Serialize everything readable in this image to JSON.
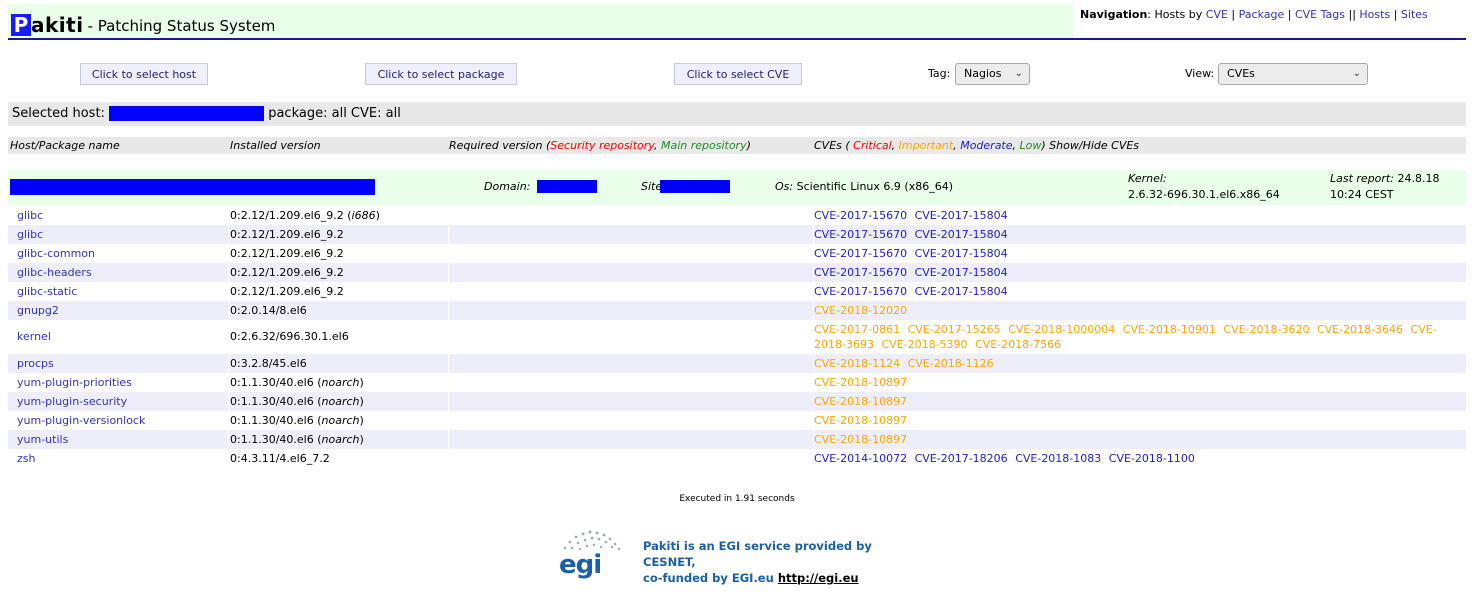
{
  "header": {
    "logo_first": "P",
    "logo_rest": "akiti",
    "subtitle": "- Patching Status System",
    "nav": {
      "label": "Navigation",
      "prefix": ": Hosts by ",
      "items": [
        "CVE",
        "Package",
        "CVE Tags",
        "Hosts",
        "Sites"
      ]
    }
  },
  "selectors": {
    "host_button": "Click to select host",
    "package_button": "Click to select package",
    "cve_button": "Click to select CVE",
    "tag_label": "Tag:",
    "tag_value": "Nagios",
    "view_label": "View:",
    "view_value": "CVEs"
  },
  "selected": {
    "host_label": "Selected host:",
    "package_text": "package: all CVE: all"
  },
  "columns": {
    "name": "Host/Package name",
    "installed": "Installed version",
    "required_prefix": "Required version (",
    "security_repo": "Security repository",
    "main_repo": "Main repository",
    "required_suffix": ")",
    "cves_prefix": "CVEs ( ",
    "critical": "Critical",
    "important": "Important",
    "moderate": "Moderate",
    "low": "Low",
    "cves_suffix": ") Show/Hide CVEs"
  },
  "host": {
    "domain_label": "Domain:",
    "site_label": "Site:",
    "os_label": "Os:",
    "os_value": "Scientific Linux 6.9 (x86_64)",
    "kernel_label": "Kernel:",
    "kernel_value": "2.6.32-696.30.1.el6.x86_64",
    "report_label": "Last report:",
    "report_date": "24.8.18",
    "report_time": "10:24 CEST"
  },
  "packages": [
    {
      "name": "glibc",
      "version": "0:2.12/1.209.el6_9.2",
      "arch": "i686",
      "severity": "moderate",
      "cves": [
        "CVE-2017-15670",
        "CVE-2017-15804"
      ]
    },
    {
      "name": "glibc",
      "version": "0:2.12/1.209.el6_9.2",
      "arch": "",
      "severity": "moderate",
      "cves": [
        "CVE-2017-15670",
        "CVE-2017-15804"
      ]
    },
    {
      "name": "glibc-common",
      "version": "0:2.12/1.209.el6_9.2",
      "arch": "",
      "severity": "moderate",
      "cves": [
        "CVE-2017-15670",
        "CVE-2017-15804"
      ]
    },
    {
      "name": "glibc-headers",
      "version": "0:2.12/1.209.el6_9.2",
      "arch": "",
      "severity": "moderate",
      "cves": [
        "CVE-2017-15670",
        "CVE-2017-15804"
      ]
    },
    {
      "name": "glibc-static",
      "version": "0:2.12/1.209.el6_9.2",
      "arch": "",
      "severity": "moderate",
      "cves": [
        "CVE-2017-15670",
        "CVE-2017-15804"
      ]
    },
    {
      "name": "gnupg2",
      "version": "0:2.0.14/8.el6",
      "arch": "",
      "severity": "important",
      "cves": [
        "CVE-2018-12020"
      ]
    },
    {
      "name": "kernel",
      "version": "0:2.6.32/696.30.1.el6",
      "arch": "",
      "severity": "important",
      "cves": [
        "CVE-2017-0861",
        "CVE-2017-15265",
        "CVE-2018-1000004",
        "CVE-2018-10901",
        "CVE-2018-3620",
        "CVE-2018-3646",
        "CVE-2018-3693",
        "CVE-2018-5390",
        "CVE-2018-7566"
      ]
    },
    {
      "name": "procps",
      "version": "0:3.2.8/45.el6",
      "arch": "",
      "severity": "important",
      "cves": [
        "CVE-2018-1124",
        "CVE-2018-1126"
      ]
    },
    {
      "name": "yum-plugin-priorities",
      "version": "0:1.1.30/40.el6",
      "arch": "noarch",
      "severity": "important",
      "cves": [
        "CVE-2018-10897"
      ]
    },
    {
      "name": "yum-plugin-security",
      "version": "0:1.1.30/40.el6",
      "arch": "noarch",
      "severity": "important",
      "cves": [
        "CVE-2018-10897"
      ]
    },
    {
      "name": "yum-plugin-versionlock",
      "version": "0:1.1.30/40.el6",
      "arch": "noarch",
      "severity": "important",
      "cves": [
        "CVE-2018-10897"
      ]
    },
    {
      "name": "yum-utils",
      "version": "0:1.1.30/40.el6",
      "arch": "noarch",
      "severity": "important",
      "cves": [
        "CVE-2018-10897"
      ]
    },
    {
      "name": "zsh",
      "version": "0:4.3.11/4.el6_7.2",
      "arch": "",
      "severity": "moderate",
      "cves": [
        "CVE-2014-10072",
        "CVE-2017-18206",
        "CVE-2018-1083",
        "CVE-2018-1100"
      ]
    }
  ],
  "footer": {
    "executed": "Executed in 1.91 seconds",
    "egi_line1": "Pakiti is an EGI service provided by CESNET,",
    "egi_line2_prefix": "co-funded by EGI.eu ",
    "egi_link": "http://egi.eu",
    "egi_logo": "egi"
  },
  "colors": {
    "critical": "#ff0000",
    "important": "#ffa500",
    "moderate": "#2222cc",
    "low": "#228b22",
    "redaction": "#0000ff",
    "header_bg": "#eaffea"
  }
}
